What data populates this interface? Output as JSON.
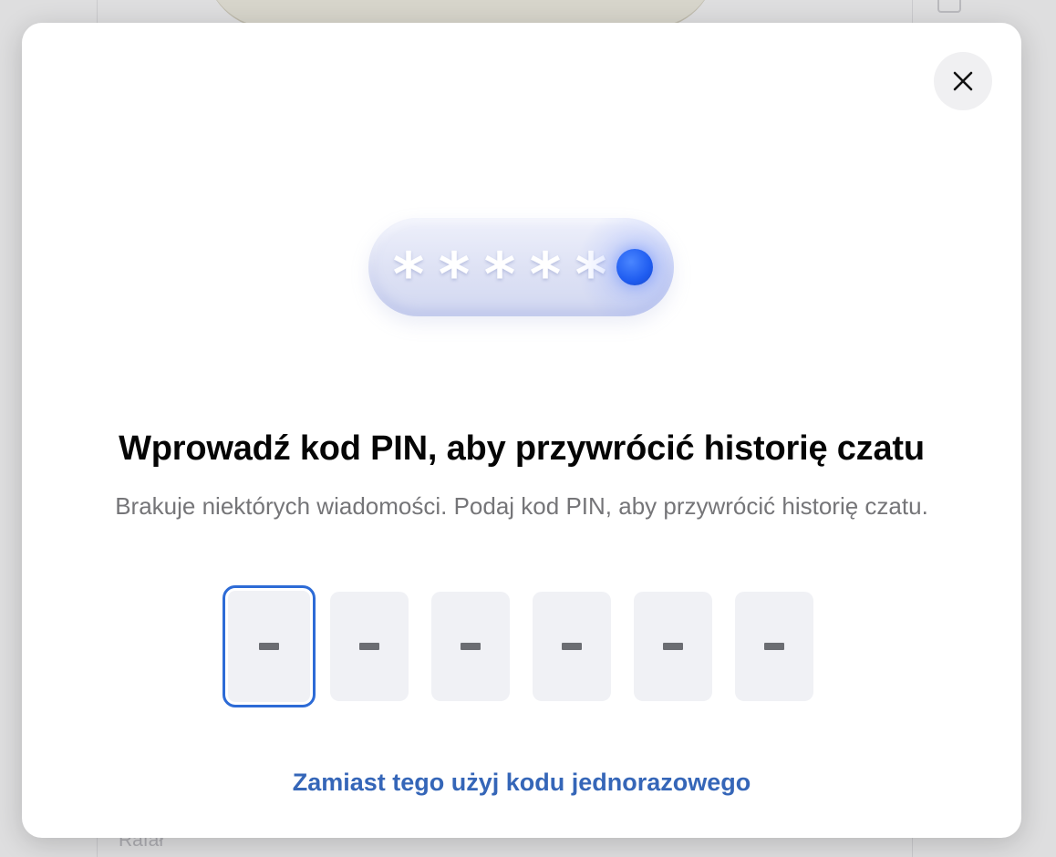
{
  "background": {
    "contact_name": "Rafał"
  },
  "dialog": {
    "title": "Wprowadź kod PIN, aby przywrócić historię czatu",
    "subtitle": "Brakuje niektórych wiadomości. Podaj kod PIN, aby przywrócić historię czatu.",
    "close_icon": "close-icon",
    "illustration": {
      "masked_characters": [
        "*",
        "*",
        "*",
        "*",
        "*"
      ],
      "accent_color": "#1f5cf0"
    },
    "pin_inputs": [
      {
        "placeholder": "-"
      },
      {
        "placeholder": "-"
      },
      {
        "placeholder": "-"
      },
      {
        "placeholder": "-"
      },
      {
        "placeholder": "-"
      },
      {
        "placeholder": "-"
      }
    ],
    "alt_link_label": "Zamiast tego użyj kodu jednorazowego",
    "colors": {
      "link": "#3566b8",
      "focus_border": "#2d6bd6"
    }
  }
}
